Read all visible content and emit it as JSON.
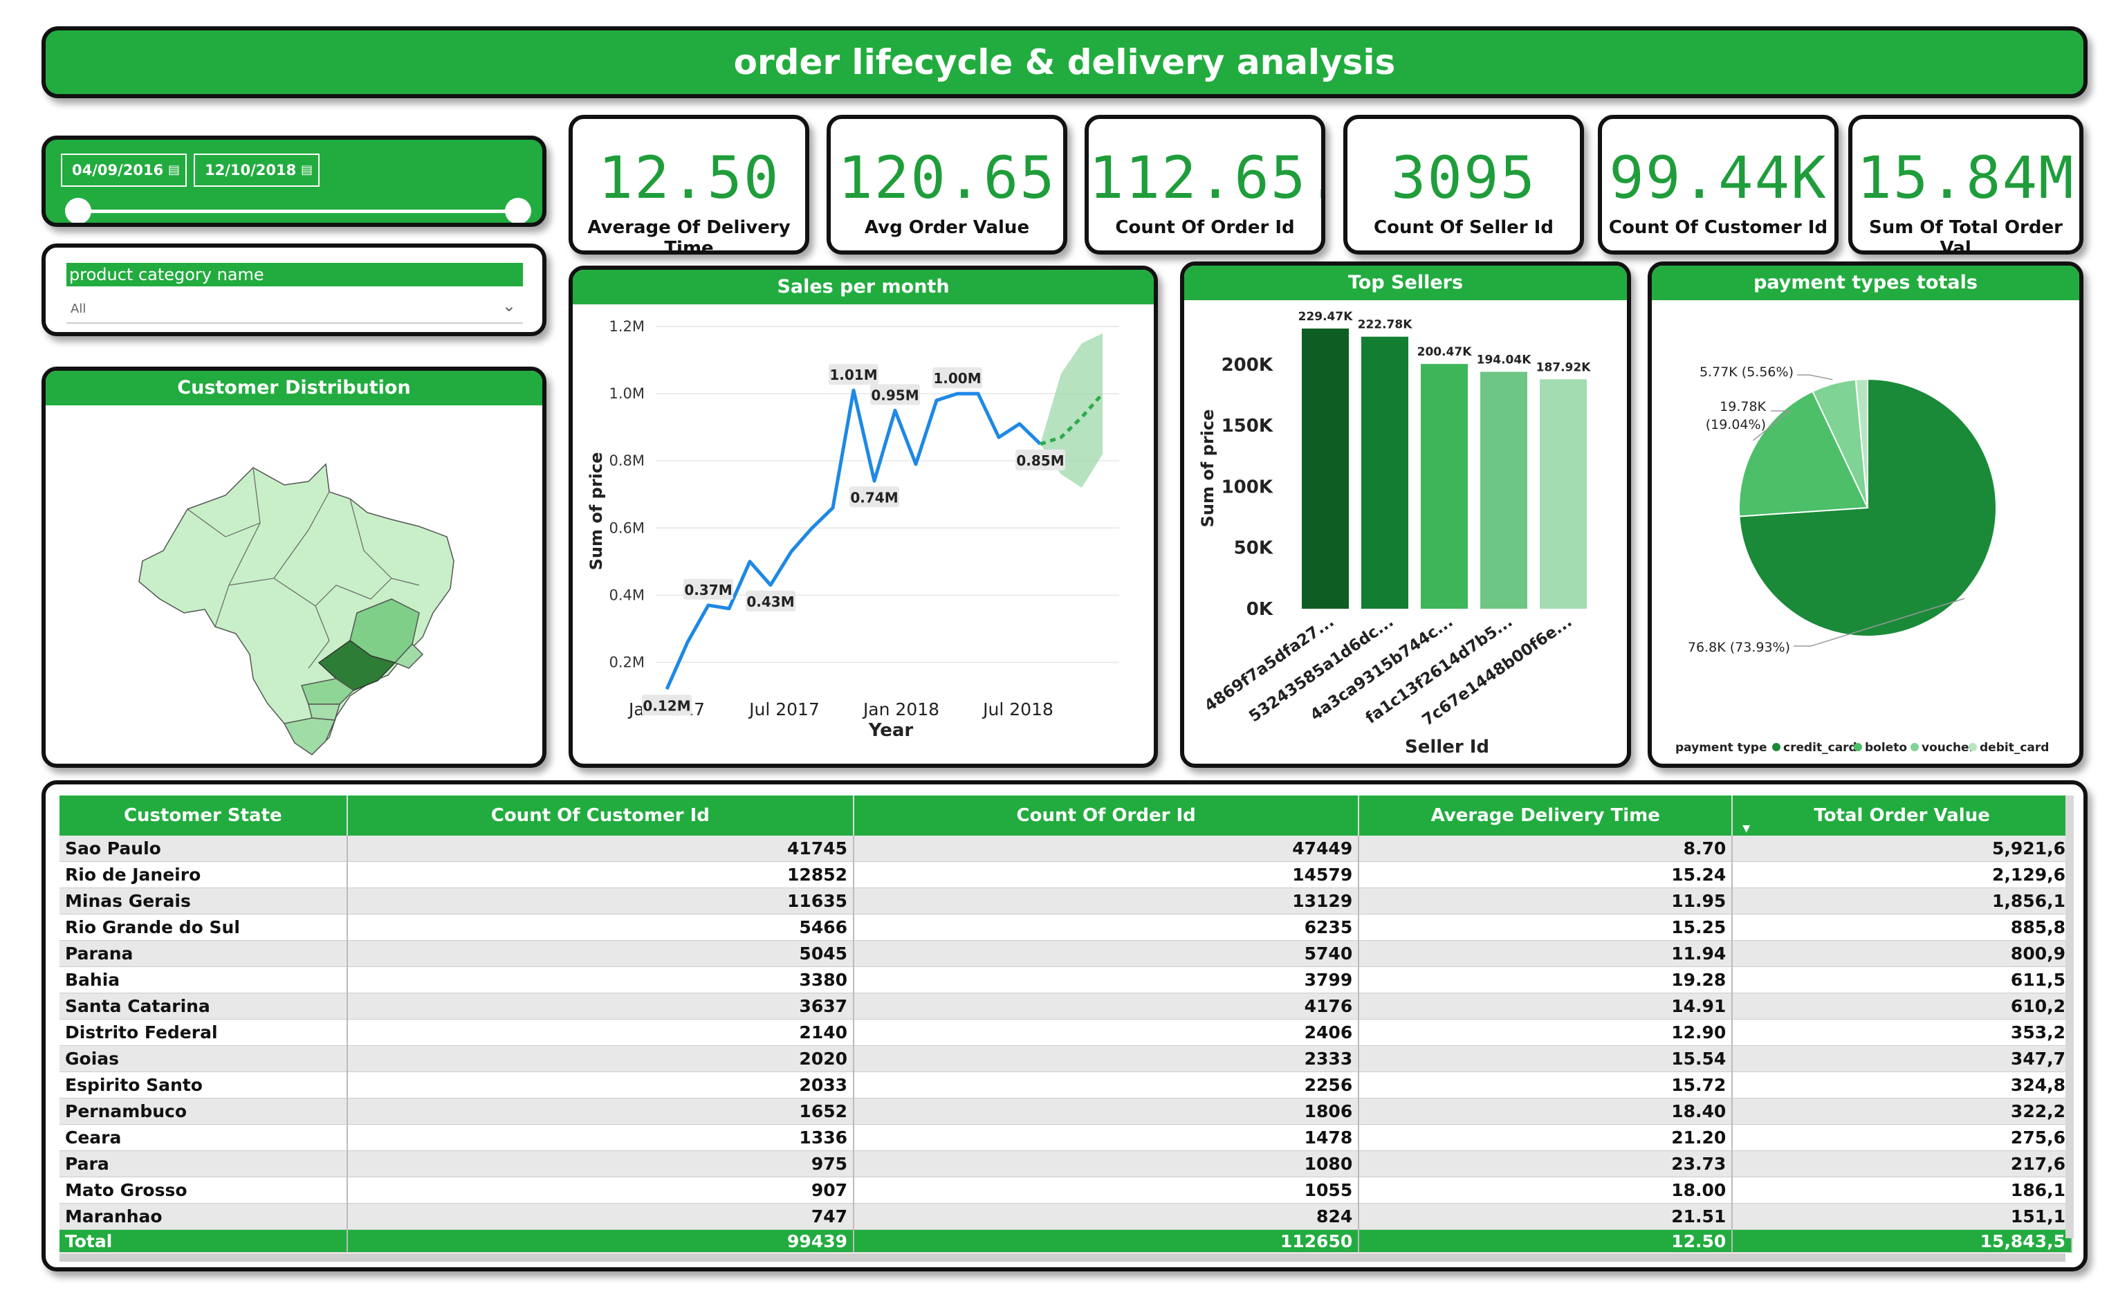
{
  "title": "order lifecycle & delivery analysis",
  "date_filter": {
    "start": "04/09/2016",
    "end": "12/10/2018",
    "calendar_icon": "calendar-icon"
  },
  "category_filter": {
    "label": "product category name",
    "value": "All",
    "chevron_icon": "chevron-down-icon"
  },
  "kpis": [
    {
      "value": "12.50",
      "label": "Average Of Delivery Time"
    },
    {
      "value": "120.65",
      "label": "Avg Order Value"
    },
    {
      "value": "112.65...",
      "label": "Count Of Order Id"
    },
    {
      "value": "3095",
      "label": "Count Of Seller Id"
    },
    {
      "value": "99.44K",
      "label": "Count Of Customer Id"
    },
    {
      "value": "15.84M",
      "label": "Sum Of Total Order Val..."
    }
  ],
  "map": {
    "title": "Customer Distribution"
  },
  "colors": {
    "accent": "#22ac3f",
    "line": "#1e88e5",
    "forecast": "#2eaa4a"
  },
  "chart_data": [
    {
      "type": "line",
      "title": "Sales per month",
      "xlabel": "Year",
      "ylabel": "Sum of price",
      "ylim": [
        0.1,
        1.2
      ],
      "yticks": [
        0.2,
        0.4,
        0.6,
        0.8,
        1.0,
        1.2
      ],
      "ytick_labels": [
        "0.2M",
        "0.4M",
        "0.6M",
        "0.8M",
        "1.0M",
        "1.2M"
      ],
      "xticks": [
        "Jan 2017",
        "Jul 2017",
        "Jan 2018",
        "Jul 2018"
      ],
      "x": [
        0,
        1,
        2,
        3,
        4,
        5,
        6,
        7,
        8,
        9,
        10,
        11,
        12,
        13,
        14,
        15,
        16,
        17,
        18,
        19,
        20
      ],
      "values": [
        0.12,
        0.26,
        0.37,
        0.36,
        0.5,
        0.43,
        0.53,
        0.6,
        0.66,
        1.01,
        0.74,
        0.95,
        0.79,
        0.98,
        1.0,
        1.0,
        0.87,
        0.91,
        0.85
      ],
      "data_labels": [
        {
          "i": 0,
          "text": "0.12M"
        },
        {
          "i": 2,
          "text": "0.37M"
        },
        {
          "i": 5,
          "text": "0.43M"
        },
        {
          "i": 9,
          "text": "1.01M"
        },
        {
          "i": 10,
          "text": "0.74M"
        },
        {
          "i": 11,
          "text": "0.95M"
        },
        {
          "i": 14,
          "text": "1.00M"
        },
        {
          "i": 18,
          "text": "0.85M"
        }
      ],
      "forecast": [
        0.85,
        0.87,
        0.93,
        1.0
      ],
      "forecast_upper": [
        0.85,
        1.06,
        1.15,
        1.18
      ],
      "forecast_lower": [
        0.85,
        0.76,
        0.72,
        0.82
      ],
      "grid": true
    },
    {
      "type": "bar",
      "title": "Top Sellers",
      "xlabel": "Seller Id",
      "ylabel": "Sum of price",
      "ylim": [
        0,
        230000
      ],
      "yticks": [
        0,
        50000,
        100000,
        150000,
        200000
      ],
      "ytick_labels": [
        "0K",
        "50K",
        "100K",
        "150K",
        "200K"
      ],
      "categories": [
        "4869f7a5dfa27...",
        "53243585a1d6dc...",
        "4a3ca9315b744c...",
        "fa1c13f2614d7b5...",
        "7c67e1448b00f6e..."
      ],
      "values": [
        229470,
        222780,
        200470,
        194040,
        187920
      ],
      "data_labels": [
        "229.47K",
        "222.78K",
        "200.47K",
        "194.04K",
        "187.92K"
      ],
      "bar_colors": [
        "#0e5e24",
        "#137d31",
        "#3fb55a",
        "#6ec684",
        "#a3dcb0"
      ]
    },
    {
      "type": "pie",
      "title": "payment types totals",
      "legend_title": "payment type",
      "legend": "bottom",
      "categories": [
        "credit_card",
        "boleto",
        "voucher",
        "debit_card"
      ],
      "values": [
        76.8,
        19.78,
        5.77,
        1.53
      ],
      "colors": [
        "#1a8a39",
        "#4cbf68",
        "#7fd394",
        "#b6e6c1"
      ],
      "data_labels": [
        {
          "i": 0,
          "text": "76.8K (73.93%)"
        },
        {
          "i": 1,
          "text": "19.78K",
          "text2": "(19.04%)"
        },
        {
          "i": 2,
          "text": "5.77K (5.56%)"
        }
      ]
    }
  ],
  "table": {
    "columns": [
      "Customer State",
      "Count Of Customer Id",
      "Count Of Order Id",
      "Average Delivery Time",
      "Total Order Value"
    ],
    "sort_icon": "sort-desc-icon",
    "rows": [
      [
        "Sao Paulo",
        "41745",
        "47449",
        "8.70",
        "5,921,6"
      ],
      [
        "Rio de Janeiro",
        "12852",
        "14579",
        "15.24",
        "2,129,6"
      ],
      [
        "Minas Gerais",
        "11635",
        "13129",
        "11.95",
        "1,856,1"
      ],
      [
        "Rio Grande do Sul",
        "5466",
        "6235",
        "15.25",
        "885,8"
      ],
      [
        "Parana",
        "5045",
        "5740",
        "11.94",
        "800,9"
      ],
      [
        "Bahia",
        "3380",
        "3799",
        "19.28",
        "611,5"
      ],
      [
        "Santa Catarina",
        "3637",
        "4176",
        "14.91",
        "610,2"
      ],
      [
        "Distrito Federal",
        "2140",
        "2406",
        "12.90",
        "353,2"
      ],
      [
        "Goias",
        "2020",
        "2333",
        "15.54",
        "347,7"
      ],
      [
        "Espirito Santo",
        "2033",
        "2256",
        "15.72",
        "324,8"
      ],
      [
        "Pernambuco",
        "1652",
        "1806",
        "18.40",
        "322,2"
      ],
      [
        "Ceara",
        "1336",
        "1478",
        "21.20",
        "275,6"
      ],
      [
        "Para",
        "975",
        "1080",
        "23.73",
        "217,6"
      ],
      [
        "Mato Grosso",
        "907",
        "1055",
        "18.00",
        "186,1"
      ],
      [
        "Maranhao",
        "747",
        "824",
        "21.51",
        "151,1"
      ]
    ],
    "total": [
      "Total",
      "99439",
      "112650",
      "12.50",
      "15,843,5"
    ]
  }
}
